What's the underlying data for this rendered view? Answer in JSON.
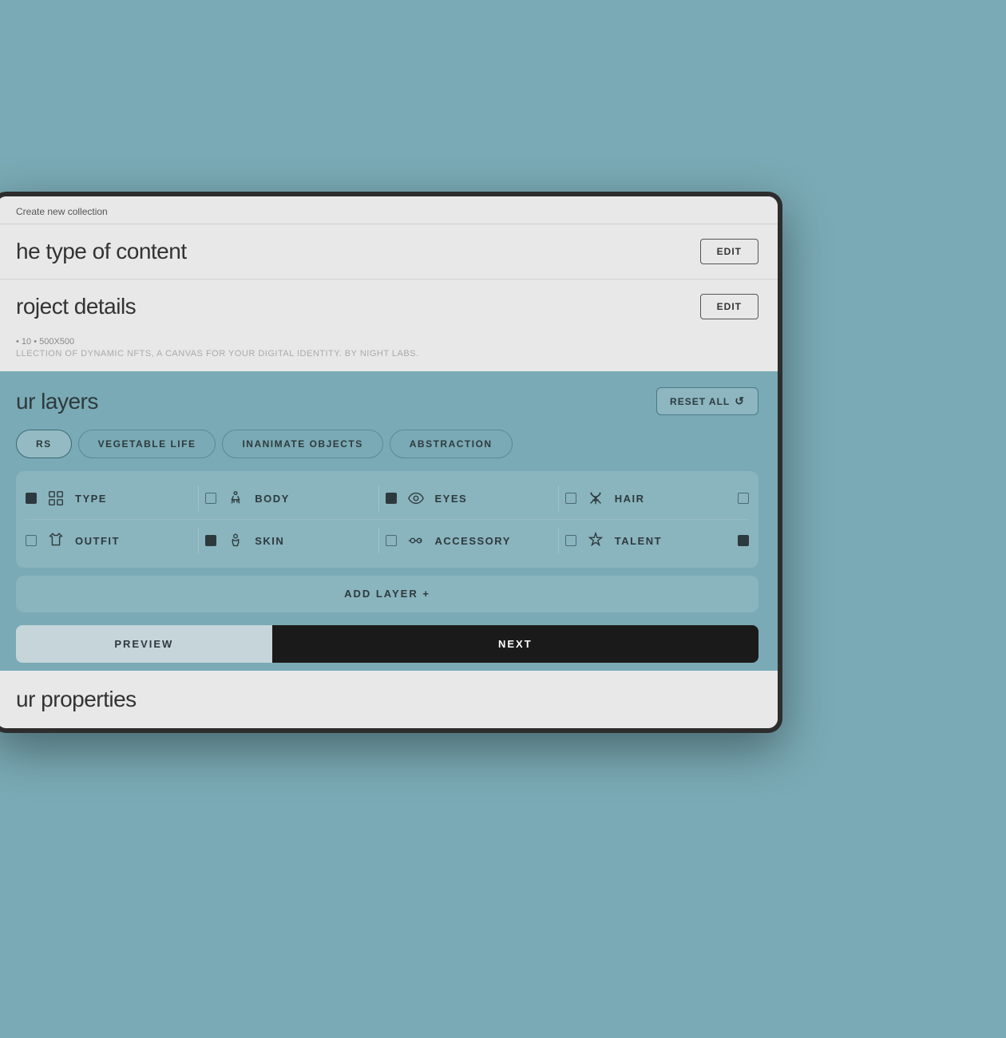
{
  "breadcrumb": {
    "label": "Create new collection"
  },
  "content_type_section": {
    "title": "he type of content",
    "edit_label": "EDIT"
  },
  "project_details_section": {
    "title": "roject details",
    "edit_label": "EDIT",
    "meta": "• 10 • 500X500",
    "description": "LLECTION OF DYNAMIC NFTS, A CANVAS FOR YOUR DIGITAL IDENTITY. BY NIGHT LABS."
  },
  "layers_section": {
    "title": "ur layers",
    "reset_label": "RESET ALL",
    "reset_icon": "↺",
    "tabs": [
      {
        "id": "tab-characters",
        "label": "RS",
        "active": true
      },
      {
        "id": "tab-vegetable",
        "label": "VEGETABLE LIFE",
        "active": false
      },
      {
        "id": "tab-inanimate",
        "label": "INANIMATE OBJECTS",
        "active": false
      },
      {
        "id": "tab-abstraction",
        "label": "ABSTRACTION",
        "active": false
      }
    ],
    "layers_row1": [
      {
        "id": "type",
        "label": "TYPE",
        "icon": "grid",
        "checked": true
      },
      {
        "id": "body",
        "label": "BODY",
        "icon": "person",
        "checked": false
      },
      {
        "id": "eyes",
        "label": "EYES",
        "icon": "eye",
        "checked": true
      },
      {
        "id": "hair",
        "label": "HAIR",
        "icon": "scissors",
        "checked": false
      }
    ],
    "layers_row2": [
      {
        "id": "outfit",
        "label": "OUTFIT",
        "icon": "shirt",
        "checked": false
      },
      {
        "id": "skin",
        "label": "SKIN",
        "icon": "person2",
        "checked": true
      },
      {
        "id": "accessory",
        "label": "ACCESSORY",
        "icon": "glasses",
        "checked": false
      },
      {
        "id": "talent",
        "label": "TALENT",
        "icon": "star",
        "checked": true
      }
    ],
    "add_layer_label": "ADD LAYER  +"
  },
  "bottom_nav": {
    "preview_label": "PREVIEW",
    "next_label": "NEXT"
  },
  "ur_properties": {
    "title": "ur properties"
  }
}
